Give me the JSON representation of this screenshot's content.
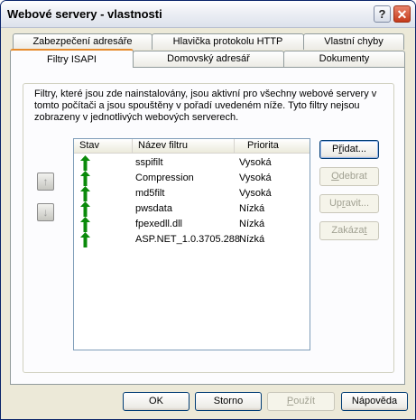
{
  "window": {
    "title": "Webové servery - vlastnosti",
    "help_glyph": "?",
    "close_glyph": "✕"
  },
  "tabs_back": [
    "Zabezpečení adresáře",
    "Hlavička protokolu HTTP",
    "Vlastní chyby"
  ],
  "tabs_front": [
    "Filtry ISAPI",
    "Domovský adresář",
    "Dokumenty"
  ],
  "active_tab": "Filtry ISAPI",
  "description": "Filtry, které jsou zde nainstalovány, jsou aktivní pro všechny webové servery v tomto počítači a jsou spouštěny v pořadí uvedeném níže. Tyto filtry nejsou zobrazeny v jednotlivých webových serverech.",
  "filters": {
    "columns": [
      "Stav",
      "Název filtru",
      "Priorita"
    ],
    "rows": [
      {
        "name": "sspifilt",
        "priority": "Vysoká"
      },
      {
        "name": "Compression",
        "priority": "Vysoká"
      },
      {
        "name": "md5filt",
        "priority": "Vysoká"
      },
      {
        "name": "pwsdata",
        "priority": "Nízká"
      },
      {
        "name": "fpexedll.dll",
        "priority": "Nízká"
      },
      {
        "name": "ASP.NET_1.0.3705.288",
        "priority": "Nízká"
      }
    ]
  },
  "side_buttons": {
    "up_glyph": "↑",
    "down_glyph": "↓"
  },
  "actions": {
    "add_pre": "P",
    "add_key": "ř",
    "add_post": "idat...",
    "remove_key": "O",
    "remove_post": "debrat",
    "edit_pre": "Up",
    "edit_key": "r",
    "edit_post": "avit...",
    "disable_pre": "Zakáza",
    "disable_key": "t",
    "disable_post": ""
  },
  "footer": {
    "ok": "OK",
    "cancel": "Storno",
    "apply_key": "P",
    "apply_post": "oužít",
    "help": "Nápověda"
  },
  "colors": {
    "arrow_green": "#0a8a0a",
    "active_tab_accent": "#e68b2c"
  }
}
